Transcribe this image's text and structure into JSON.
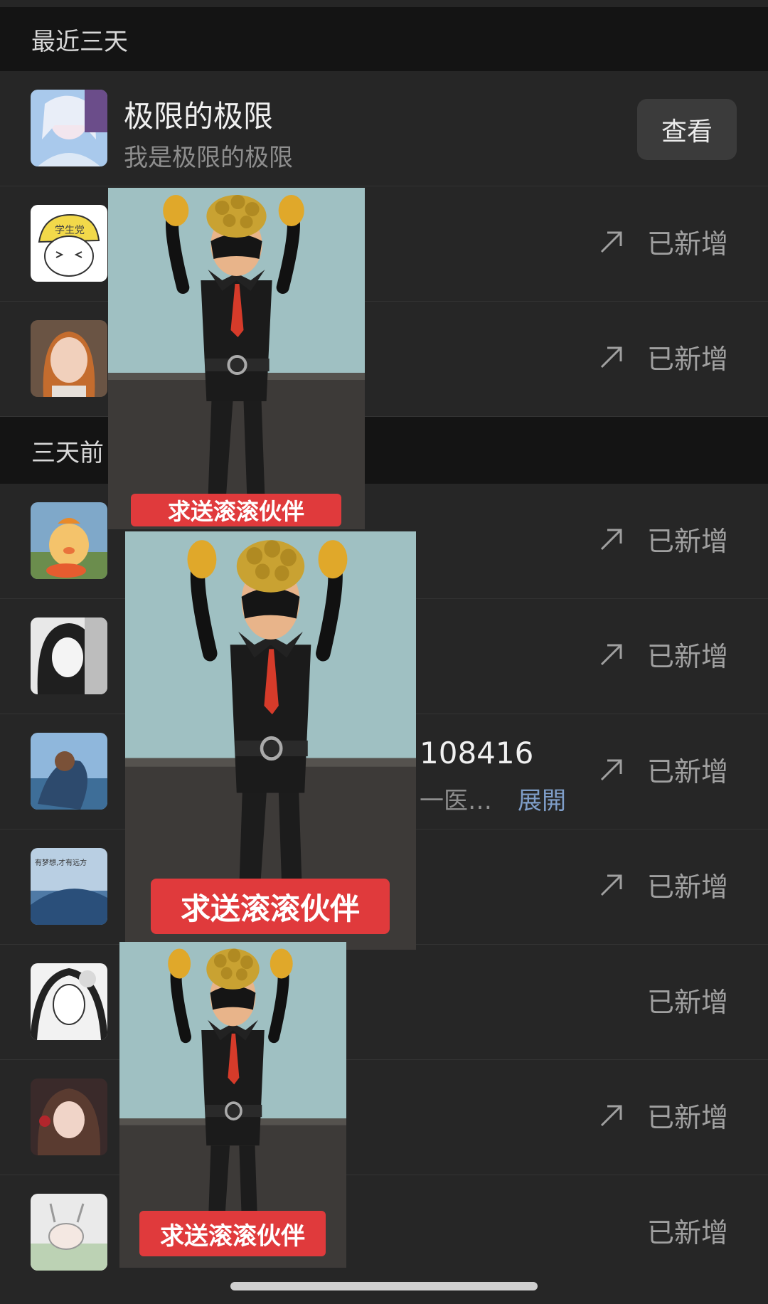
{
  "sections": {
    "recent": "最近三天",
    "older": "三天前"
  },
  "top_item": {
    "name": "极限的极限",
    "subtitle": "我是极限的极限",
    "button": "查看"
  },
  "rows": [
    {
      "status": "已新增",
      "arrow": true
    },
    {
      "status": "已新增",
      "arrow": true
    },
    {
      "status": "已新增",
      "arrow": true
    },
    {
      "status": "已新增",
      "arrow": true
    },
    {
      "status": "已新增",
      "arrow": true,
      "partial_name": "108416",
      "partial_sub": "一医…",
      "expand": "展開"
    },
    {
      "status": "已新增",
      "arrow": true
    },
    {
      "status": "已新增",
      "arrow": false
    },
    {
      "status": "已新增",
      "arrow": true
    },
    {
      "status": "已新增",
      "arrow": false
    }
  ],
  "overlay_caption": "求送滚滚伙伴",
  "avatar_texts": {
    "cap": "学生党",
    "whale": "有梦想,才有远方"
  },
  "colors": {
    "background": "#262626",
    "header": "#141414",
    "caption_red": "#e03a3c",
    "link": "#7f9ec9"
  }
}
